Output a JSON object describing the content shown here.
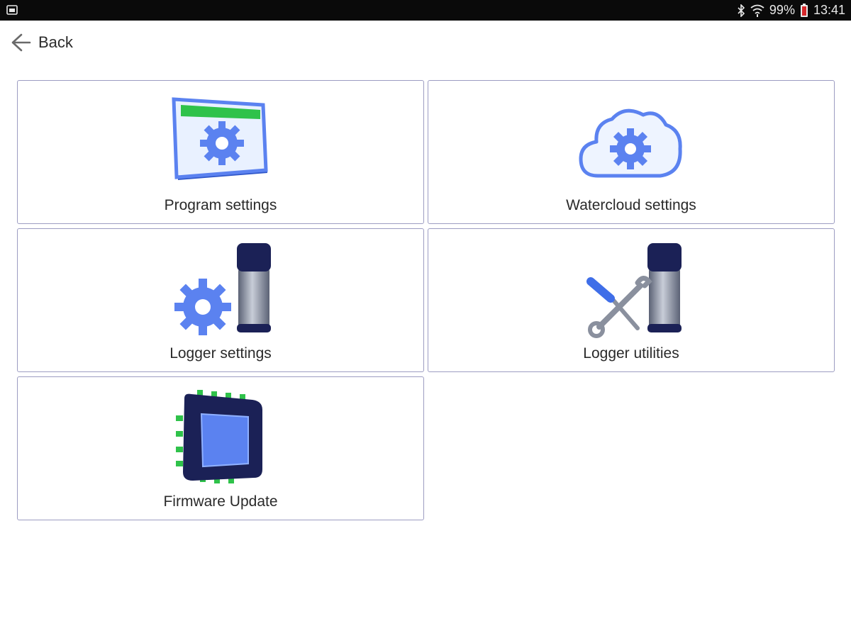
{
  "status_bar": {
    "battery_percent": "99%",
    "time": "13:41",
    "icons": [
      "screenshot-icon",
      "bluetooth-icon",
      "wifi-icon",
      "battery-icon"
    ]
  },
  "nav": {
    "back_label": "Back",
    "back_icon": "arrow-left-icon"
  },
  "menu": {
    "tiles": [
      {
        "label": "Program settings",
        "icon": "program-settings-icon"
      },
      {
        "label": "Watercloud settings",
        "icon": "cloud-gear-icon"
      },
      {
        "label": "Logger settings",
        "icon": "logger-gear-icon"
      },
      {
        "label": "Logger utilities",
        "icon": "logger-tools-icon"
      },
      {
        "label": "Firmware Update",
        "icon": "chip-icon"
      }
    ]
  },
  "colors": {
    "tile_border": "#9c9cc2",
    "accent_blue": "#5b82f0",
    "accent_green": "#2fc24a",
    "navy": "#1b2156"
  }
}
